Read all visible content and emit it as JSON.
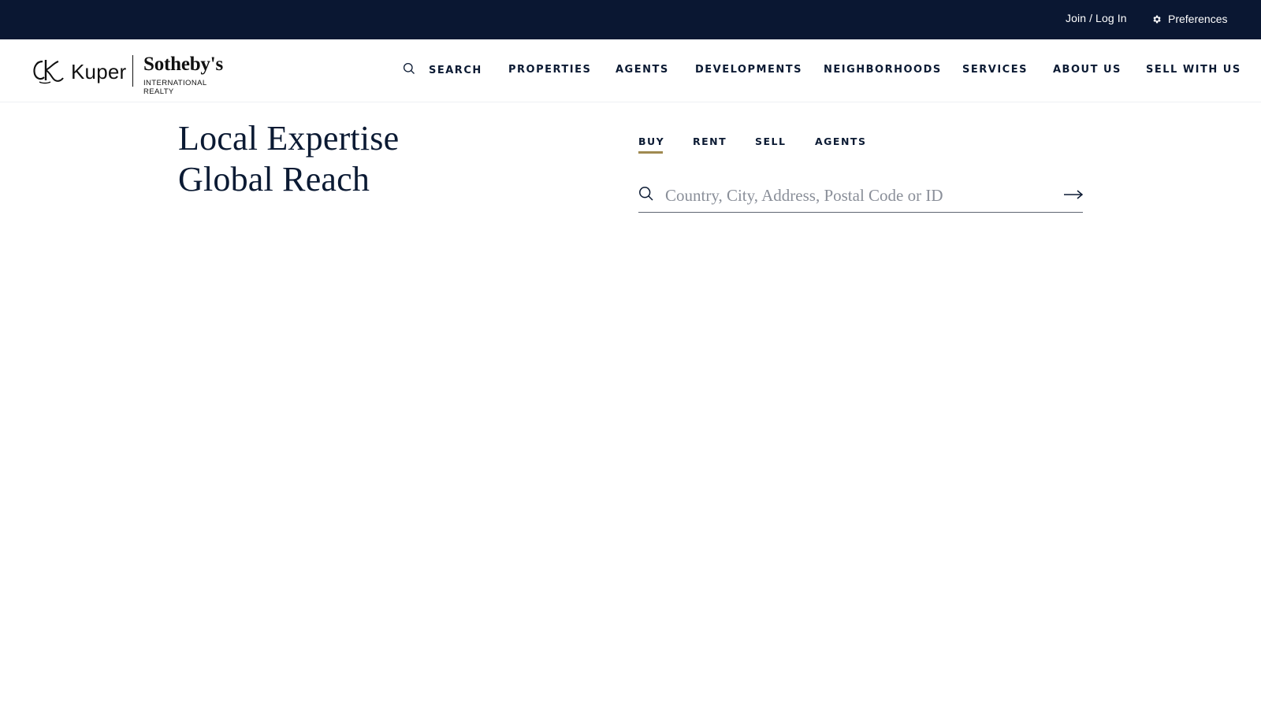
{
  "topbar": {
    "join_login": "Join / Log In",
    "preferences": "Preferences",
    "background": "#0a1732"
  },
  "brand": {
    "name": "Kuper",
    "partner": "Sotheby's",
    "tagline": "INTERNATIONAL REALTY",
    "logo_icon": "kuper-monogram-icon"
  },
  "nav": {
    "search_label": "SEARCH",
    "search_icon": "search-icon",
    "items": [
      {
        "label": "PROPERTIES"
      },
      {
        "label": "AGENTS"
      },
      {
        "label": "DEVELOPMENTS"
      },
      {
        "label": "NEIGHBORHOODS"
      },
      {
        "label": "SERVICES"
      },
      {
        "label": "ABOUT US"
      },
      {
        "label": "SELL WITH US"
      }
    ]
  },
  "hero": {
    "headline_line1": "Local Expertise",
    "headline_line2": "Global Reach"
  },
  "search_tabs": {
    "active": "BUY",
    "accent": "#a08a50",
    "items": [
      {
        "label": "BUY"
      },
      {
        "label": "RENT"
      },
      {
        "label": "SELL"
      },
      {
        "label": "AGENTS"
      }
    ]
  },
  "search": {
    "placeholder": "Country, City, Address, Postal Code or ID",
    "value": "",
    "submit_icon": "arrow-right-icon"
  },
  "colors": {
    "primary_text": "#0b1a33",
    "background": "#ffffff"
  }
}
